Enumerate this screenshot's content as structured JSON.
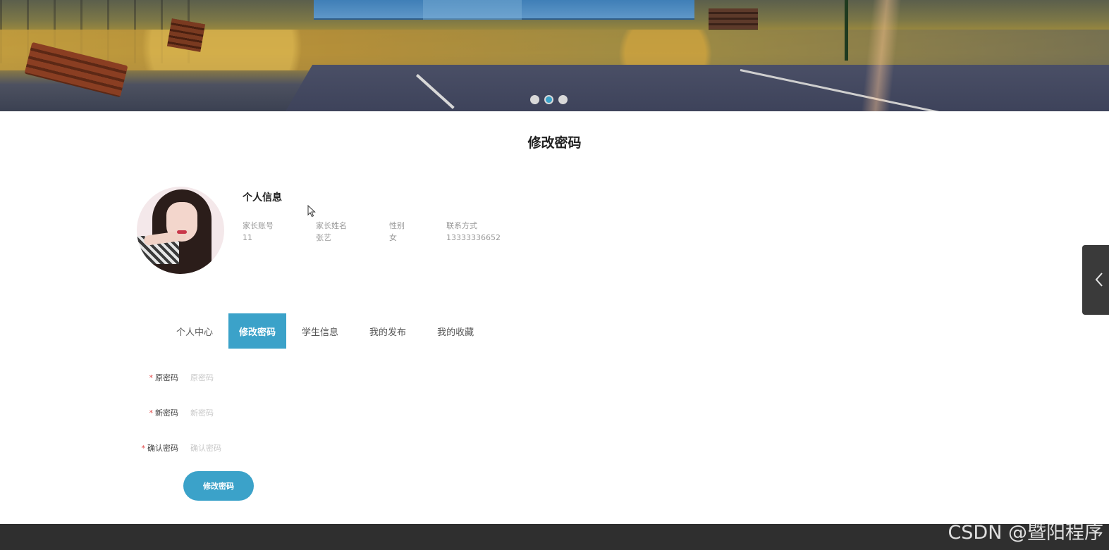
{
  "carousel": {
    "slide_count": 3,
    "active_index": 1
  },
  "page": {
    "title": "修改密码"
  },
  "profile": {
    "heading": "个人信息",
    "fields": [
      {
        "label": "家长账号",
        "value": "11"
      },
      {
        "label": "家长姓名",
        "value": "张艺"
      },
      {
        "label": "性别",
        "value": "女"
      },
      {
        "label": "联系方式",
        "value": "13333336652"
      }
    ]
  },
  "tabs": [
    {
      "label": "个人中心",
      "active": false
    },
    {
      "label": "修改密码",
      "active": true
    },
    {
      "label": "学生信息",
      "active": false
    },
    {
      "label": "我的发布",
      "active": false
    },
    {
      "label": "我的收藏",
      "active": false
    }
  ],
  "form": {
    "required_mark": "*",
    "fields": [
      {
        "label": "原密码",
        "placeholder": "原密码",
        "value": ""
      },
      {
        "label": "新密码",
        "placeholder": "新密码",
        "value": ""
      },
      {
        "label": "确认密码",
        "placeholder": "确认密码",
        "value": ""
      }
    ],
    "submit_label": "修改密码"
  },
  "watermark": "CSDN @暨阳程序",
  "colors": {
    "accent": "#3ba2c9",
    "footer": "#2f2f2f",
    "required": "#e04545"
  },
  "icons": {
    "side_handle": "chevron-left-icon",
    "cursor": "mouse-pointer-icon"
  }
}
